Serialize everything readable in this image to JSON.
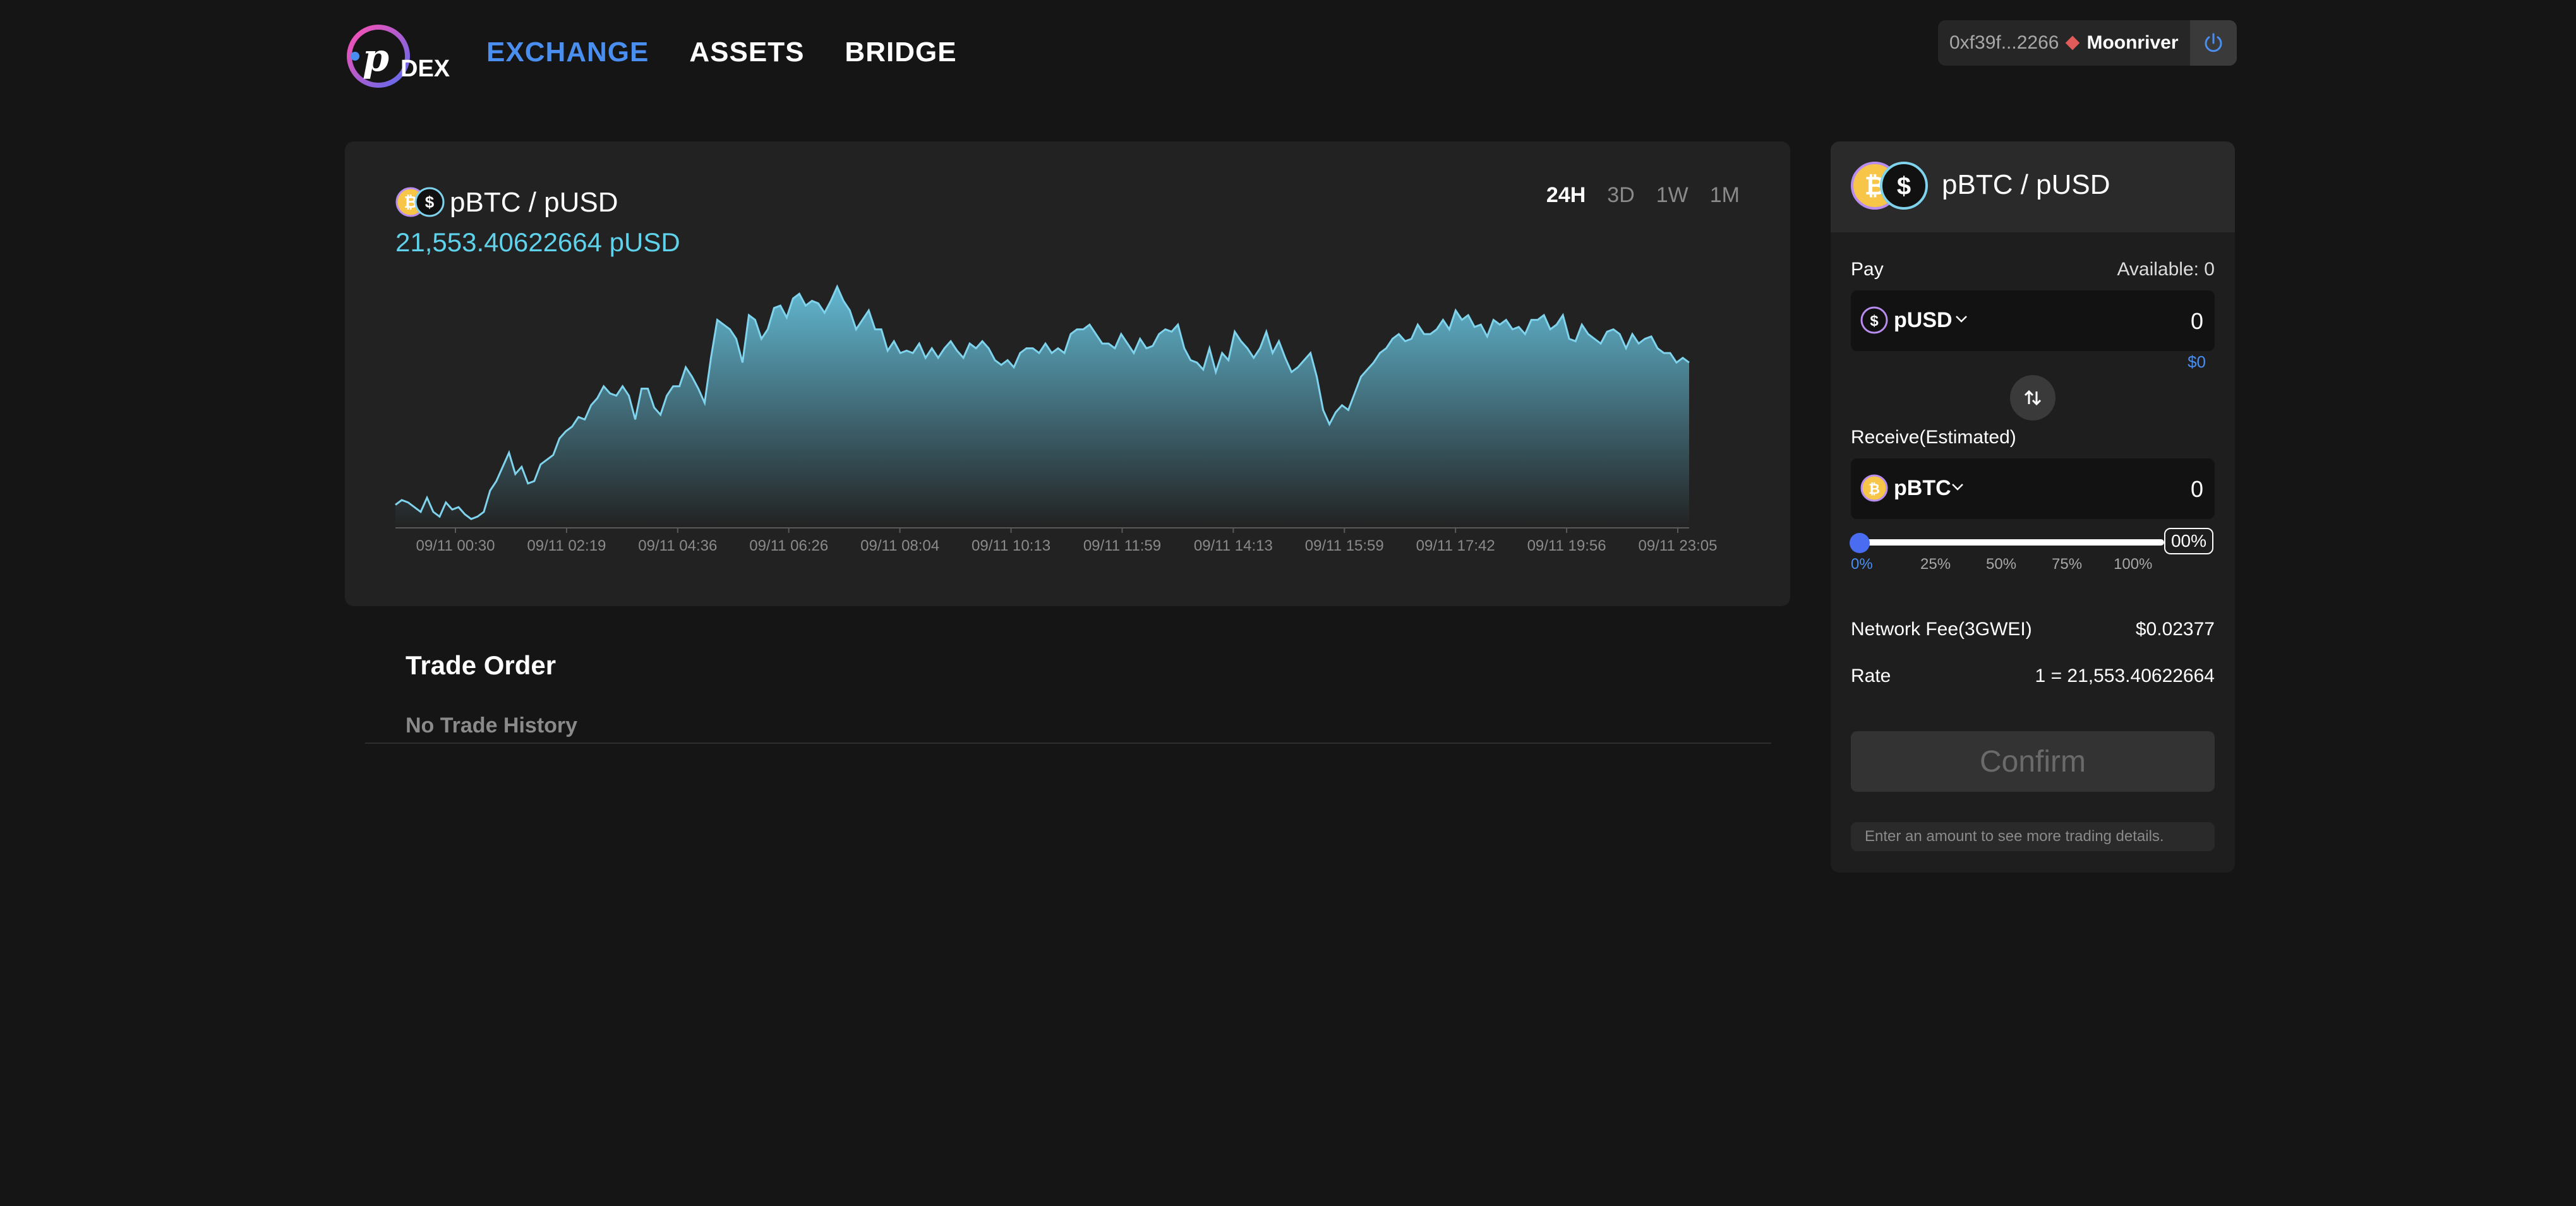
{
  "header": {
    "logo_text": "DEX",
    "nav": [
      {
        "label": "EXCHANGE",
        "active": true
      },
      {
        "label": "ASSETS",
        "active": false
      },
      {
        "label": "BRIDGE",
        "active": false
      }
    ],
    "wallet": {
      "address": "0xf39f...2266",
      "network": "Moonriver"
    }
  },
  "chart_card": {
    "pair": "pBTC / pUSD",
    "price": "21,553.40622664 pUSD",
    "ranges": [
      "24H",
      "3D",
      "1W",
      "1M"
    ],
    "active_range": "24H"
  },
  "chart_data": {
    "type": "area",
    "xlabel": "",
    "ylabel": "",
    "x_ticks": [
      "09/11 00:30",
      "09/11 02:19",
      "09/11 04:36",
      "09/11 06:26",
      "09/11 08:04",
      "09/11 10:13",
      "09/11 11:59",
      "09/11 14:13",
      "09/11 15:59",
      "09/11 17:42",
      "09/11 19:56",
      "09/11 23:05"
    ],
    "grid": false,
    "series": [
      {
        "values": [
          6,
          8,
          7,
          5,
          3,
          9,
          3,
          1,
          7,
          4,
          5,
          2,
          0,
          1,
          3,
          12,
          16,
          22,
          28,
          19,
          22,
          15,
          16,
          23,
          25,
          27,
          34,
          37,
          39,
          43,
          42,
          48,
          51,
          56,
          53,
          52,
          56,
          52,
          42,
          55,
          55,
          47,
          44,
          52,
          56,
          56,
          64,
          60,
          55,
          49,
          68,
          84,
          82,
          80,
          76,
          66,
          86,
          84,
          76,
          80,
          89,
          90,
          85,
          93,
          95,
          90,
          92,
          91,
          87,
          92,
          98,
          92,
          88,
          80,
          84,
          88,
          80,
          80,
          71,
          75,
          70,
          71,
          70,
          74,
          68,
          72,
          68,
          72,
          75,
          71,
          68,
          74,
          72,
          75,
          72,
          67,
          65,
          67,
          64,
          70,
          72,
          72,
          70,
          74,
          70,
          72,
          70,
          78,
          80,
          80,
          82,
          78,
          74,
          74,
          72,
          78,
          74,
          70,
          76,
          72,
          73,
          78,
          80,
          79,
          82,
          72,
          67,
          66,
          63,
          72,
          62,
          70,
          67,
          79,
          75,
          72,
          68,
          72,
          79,
          70,
          75,
          68,
          62,
          64,
          67,
          70,
          60,
          46,
          40,
          45,
          48,
          46,
          53,
          60,
          63,
          66,
          70,
          72,
          76,
          78,
          75,
          76,
          82,
          78,
          78,
          80,
          84,
          80,
          88,
          84,
          86,
          81,
          82,
          77,
          84,
          82,
          84,
          80,
          81,
          78,
          84,
          84,
          86,
          80,
          82,
          86,
          76,
          75,
          82,
          78,
          76,
          74,
          79,
          80,
          78,
          72,
          78,
          74,
          76,
          77,
          72,
          70,
          70,
          66,
          68,
          66
        ]
      }
    ]
  },
  "trade_order": {
    "title": "Trade Order",
    "empty": "No Trade History"
  },
  "swap": {
    "pair": "pBTC / pUSD",
    "pay_label": "Pay",
    "available": "Available: 0",
    "pay_token": "pUSD",
    "pay_amount": "0",
    "pay_usd": "$0",
    "receive_label": "Receive(Estimated)",
    "receive_token": "pBTC",
    "receive_amount": "0",
    "slider_percent": 0,
    "slider_value": "00%",
    "slider_marks": [
      "0%",
      "25%",
      "50%",
      "75%",
      "100%"
    ],
    "fee_label": "Network Fee(3GWEI)",
    "fee_value": "$0.02377",
    "rate_label": "Rate",
    "rate_value": "1 = 21,553.40622664",
    "confirm": "Confirm",
    "hint": "Enter an amount to see more trading details."
  },
  "colors": {
    "background": "#151515",
    "card": "#222222",
    "accent": "#4a8ef0",
    "price": "#5fd3ec",
    "chart_line": "#7fd3ec"
  }
}
